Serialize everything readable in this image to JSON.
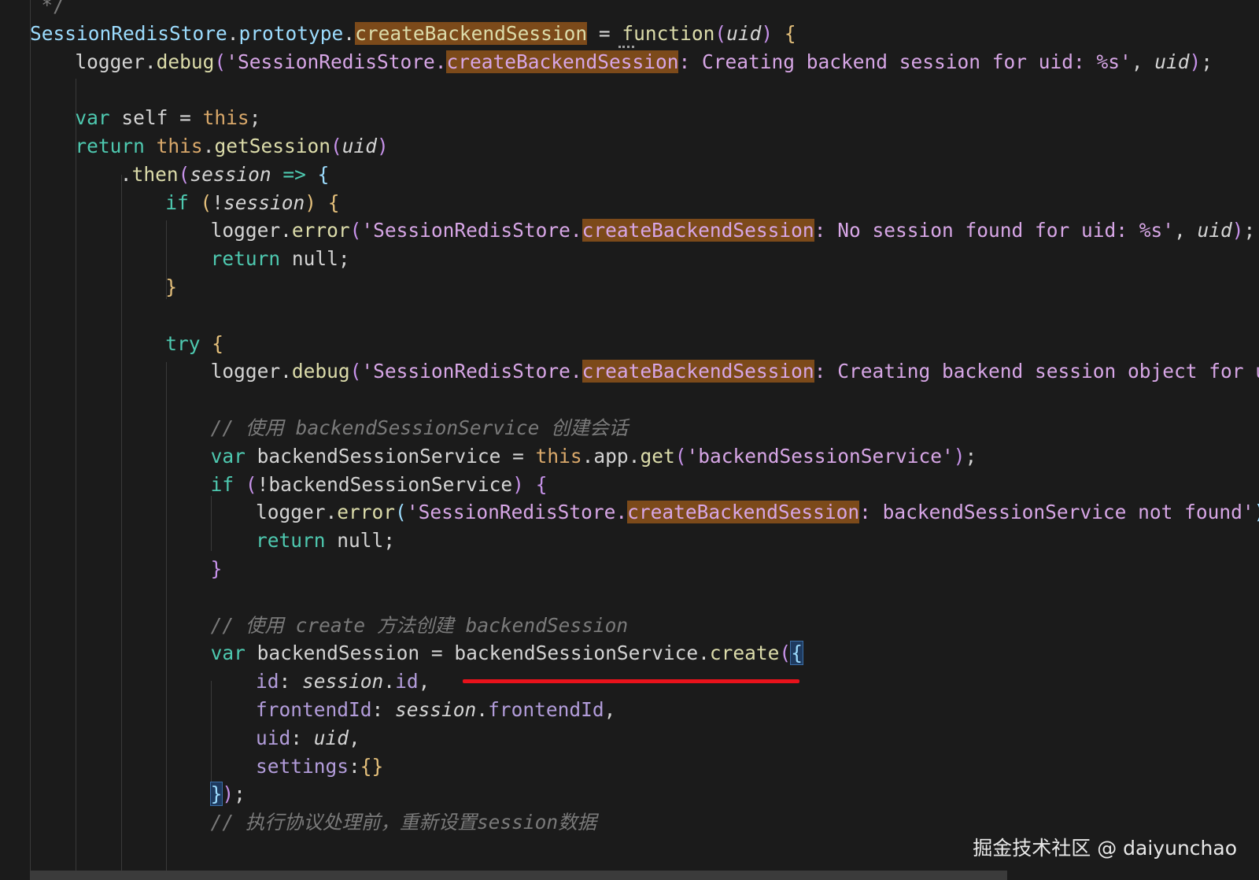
{
  "colors": {
    "background": "#1b1b1b",
    "plain": "#d4d4d4",
    "identifier_blue": "#9cdcfe",
    "keyword": "#4ec9b0",
    "method": "#dcdcaa",
    "string": "#d7a6e6",
    "this_keyword": "#d9a86a",
    "comment": "#7a7a7a",
    "param": "#d4d4d4",
    "property": "#b39ddb",
    "brace": "#e5c07b",
    "paren": "#c792ea",
    "match_highlight": "#7c4a1a",
    "annotation_red": "#e8121b"
  },
  "code_lines": [
    {
      "indent": 1,
      "tokens": [
        {
          "t": "*/",
          "c": "comment"
        }
      ]
    },
    {
      "indent": 0,
      "tokens": [
        {
          "t": "SessionRedisStore",
          "c": "identifier_blue"
        },
        {
          "t": ".",
          "c": "plain"
        },
        {
          "t": "prototype",
          "c": "identifier_blue"
        },
        {
          "t": ".",
          "c": "plain"
        },
        {
          "t": "createBackendSession",
          "c": "method",
          "hl": true
        },
        {
          "t": " = ",
          "c": "plain"
        },
        {
          "t": "function",
          "c": "method"
        },
        {
          "t": "(",
          "c": "paren"
        },
        {
          "t": "uid",
          "c": "param",
          "it": true
        },
        {
          "t": ")",
          "c": "paren"
        },
        {
          "t": " ",
          "c": "plain"
        },
        {
          "t": "{",
          "c": "brace"
        }
      ]
    },
    {
      "indent": 4,
      "tokens": [
        {
          "t": "logger",
          "c": "plain"
        },
        {
          "t": ".",
          "c": "plain"
        },
        {
          "t": "debug",
          "c": "method"
        },
        {
          "t": "(",
          "c": "paren"
        },
        {
          "t": "'SessionRedisStore.",
          "c": "string"
        },
        {
          "t": "createBackendSession",
          "c": "string",
          "hl": true
        },
        {
          "t": ": Creating backend session for uid: %s'",
          "c": "string"
        },
        {
          "t": ", ",
          "c": "plain"
        },
        {
          "t": "uid",
          "c": "param",
          "it": true
        },
        {
          "t": ")",
          "c": "paren"
        },
        {
          "t": ";",
          "c": "plain"
        }
      ]
    },
    {
      "indent": 0,
      "tokens": []
    },
    {
      "indent": 4,
      "tokens": [
        {
          "t": "var",
          "c": "keyword"
        },
        {
          "t": " self = ",
          "c": "plain"
        },
        {
          "t": "this",
          "c": "this_keyword"
        },
        {
          "t": ";",
          "c": "plain"
        }
      ]
    },
    {
      "indent": 4,
      "tokens": [
        {
          "t": "return",
          "c": "keyword"
        },
        {
          "t": " ",
          "c": "plain"
        },
        {
          "t": "this",
          "c": "this_keyword"
        },
        {
          "t": ".",
          "c": "plain"
        },
        {
          "t": "getSession",
          "c": "method"
        },
        {
          "t": "(",
          "c": "paren"
        },
        {
          "t": "uid",
          "c": "param",
          "it": true
        },
        {
          "t": ")",
          "c": "paren"
        }
      ]
    },
    {
      "indent": 8,
      "tokens": [
        {
          "t": ".",
          "c": "plain"
        },
        {
          "t": "then",
          "c": "method"
        },
        {
          "t": "(",
          "c": "paren"
        },
        {
          "t": "session",
          "c": "param",
          "it": true
        },
        {
          "t": " => ",
          "c": "keyword"
        },
        {
          "t": "{",
          "c": "identifier_blue"
        }
      ]
    },
    {
      "indent": 12,
      "tokens": [
        {
          "t": "if",
          "c": "keyword"
        },
        {
          "t": " ",
          "c": "plain"
        },
        {
          "t": "(",
          "c": "brace"
        },
        {
          "t": "!",
          "c": "plain"
        },
        {
          "t": "session",
          "c": "param",
          "it": true
        },
        {
          "t": ")",
          "c": "brace"
        },
        {
          "t": " ",
          "c": "plain"
        },
        {
          "t": "{",
          "c": "brace"
        }
      ]
    },
    {
      "indent": 16,
      "tokens": [
        {
          "t": "logger",
          "c": "plain"
        },
        {
          "t": ".",
          "c": "plain"
        },
        {
          "t": "error",
          "c": "method"
        },
        {
          "t": "(",
          "c": "paren"
        },
        {
          "t": "'SessionRedisStore.",
          "c": "string"
        },
        {
          "t": "createBackendSession",
          "c": "string",
          "hl": true
        },
        {
          "t": ": No session found for uid: %s'",
          "c": "string"
        },
        {
          "t": ", ",
          "c": "plain"
        },
        {
          "t": "uid",
          "c": "param",
          "it": true
        },
        {
          "t": ")",
          "c": "paren"
        },
        {
          "t": ";",
          "c": "plain"
        }
      ]
    },
    {
      "indent": 16,
      "tokens": [
        {
          "t": "return",
          "c": "keyword"
        },
        {
          "t": " null;",
          "c": "plain"
        }
      ]
    },
    {
      "indent": 12,
      "tokens": [
        {
          "t": "}",
          "c": "brace"
        }
      ]
    },
    {
      "indent": 0,
      "tokens": []
    },
    {
      "indent": 12,
      "tokens": [
        {
          "t": "try",
          "c": "keyword"
        },
        {
          "t": " ",
          "c": "plain"
        },
        {
          "t": "{",
          "c": "brace"
        }
      ]
    },
    {
      "indent": 16,
      "tokens": [
        {
          "t": "logger",
          "c": "plain"
        },
        {
          "t": ".",
          "c": "plain"
        },
        {
          "t": "debug",
          "c": "method"
        },
        {
          "t": "(",
          "c": "paren"
        },
        {
          "t": "'SessionRedisStore.",
          "c": "string"
        },
        {
          "t": "createBackendSession",
          "c": "string",
          "hl": true
        },
        {
          "t": ": Creating backend session object for u",
          "c": "string"
        }
      ]
    },
    {
      "indent": 0,
      "tokens": []
    },
    {
      "indent": 16,
      "tokens": [
        {
          "t": "// 使用 backendSessionService 创建会话",
          "c": "comment",
          "it": true
        }
      ]
    },
    {
      "indent": 16,
      "tokens": [
        {
          "t": "var",
          "c": "keyword"
        },
        {
          "t": " backendSessionService = ",
          "c": "plain"
        },
        {
          "t": "this",
          "c": "this_keyword"
        },
        {
          "t": ".",
          "c": "plain"
        },
        {
          "t": "app",
          "c": "plain"
        },
        {
          "t": ".",
          "c": "plain"
        },
        {
          "t": "get",
          "c": "method"
        },
        {
          "t": "(",
          "c": "paren"
        },
        {
          "t": "'backendSessionService'",
          "c": "string"
        },
        {
          "t": ")",
          "c": "paren"
        },
        {
          "t": ";",
          "c": "plain"
        }
      ]
    },
    {
      "indent": 16,
      "tokens": [
        {
          "t": "if",
          "c": "keyword"
        },
        {
          "t": " ",
          "c": "plain"
        },
        {
          "t": "(",
          "c": "paren"
        },
        {
          "t": "!backendSessionService",
          "c": "plain"
        },
        {
          "t": ")",
          "c": "paren"
        },
        {
          "t": " ",
          "c": "plain"
        },
        {
          "t": "{",
          "c": "paren"
        }
      ]
    },
    {
      "indent": 20,
      "tokens": [
        {
          "t": "logger",
          "c": "plain"
        },
        {
          "t": ".",
          "c": "plain"
        },
        {
          "t": "error",
          "c": "method"
        },
        {
          "t": "(",
          "c": "identifier_blue"
        },
        {
          "t": "'SessionRedisStore.",
          "c": "string"
        },
        {
          "t": "createBackendSession",
          "c": "string",
          "hl": true
        },
        {
          "t": ": backendSessionService not found'",
          "c": "string"
        },
        {
          "t": ")",
          "c": "identifier_blue"
        }
      ]
    },
    {
      "indent": 20,
      "tokens": [
        {
          "t": "return",
          "c": "keyword"
        },
        {
          "t": " null;",
          "c": "plain"
        }
      ]
    },
    {
      "indent": 16,
      "tokens": [
        {
          "t": "}",
          "c": "paren"
        }
      ]
    },
    {
      "indent": 0,
      "tokens": []
    },
    {
      "indent": 16,
      "tokens": [
        {
          "t": "// 使用 create 方法创建 backendSession",
          "c": "comment",
          "it": true
        }
      ]
    },
    {
      "indent": 16,
      "tokens": [
        {
          "t": "var",
          "c": "keyword"
        },
        {
          "t": " backendSession = ",
          "c": "plain"
        },
        {
          "t": "backendSessionService",
          "c": "plain"
        },
        {
          "t": ".",
          "c": "plain"
        },
        {
          "t": "create",
          "c": "method"
        },
        {
          "t": "(",
          "c": "paren"
        },
        {
          "t": "{",
          "c": "identifier_blue",
          "bm": true
        }
      ]
    },
    {
      "indent": 20,
      "tokens": [
        {
          "t": "id",
          "c": "property"
        },
        {
          "t": ": ",
          "c": "plain"
        },
        {
          "t": "session",
          "c": "param",
          "it": true
        },
        {
          "t": ".",
          "c": "plain"
        },
        {
          "t": "id",
          "c": "property"
        },
        {
          "t": ",",
          "c": "plain"
        }
      ]
    },
    {
      "indent": 20,
      "tokens": [
        {
          "t": "frontendId",
          "c": "property"
        },
        {
          "t": ": ",
          "c": "plain"
        },
        {
          "t": "session",
          "c": "param",
          "it": true
        },
        {
          "t": ".",
          "c": "plain"
        },
        {
          "t": "frontendId",
          "c": "property"
        },
        {
          "t": ",",
          "c": "plain"
        }
      ]
    },
    {
      "indent": 20,
      "tokens": [
        {
          "t": "uid",
          "c": "property"
        },
        {
          "t": ": ",
          "c": "plain"
        },
        {
          "t": "uid",
          "c": "param",
          "it": true
        },
        {
          "t": ",",
          "c": "plain"
        }
      ]
    },
    {
      "indent": 20,
      "tokens": [
        {
          "t": "settings",
          "c": "property"
        },
        {
          "t": ":",
          "c": "plain"
        },
        {
          "t": "{}",
          "c": "brace"
        }
      ]
    },
    {
      "indent": 16,
      "tokens": [
        {
          "t": "}",
          "c": "identifier_blue",
          "bm": true
        },
        {
          "t": ")",
          "c": "paren"
        },
        {
          "t": ";",
          "c": "plain"
        }
      ]
    },
    {
      "indent": 16,
      "tokens": [
        {
          "t": "// 执行协议处理前，重新设置session数据",
          "c": "comment",
          "it": true
        }
      ]
    }
  ],
  "watermark": "掘金技术社区 @ daiyunchao"
}
